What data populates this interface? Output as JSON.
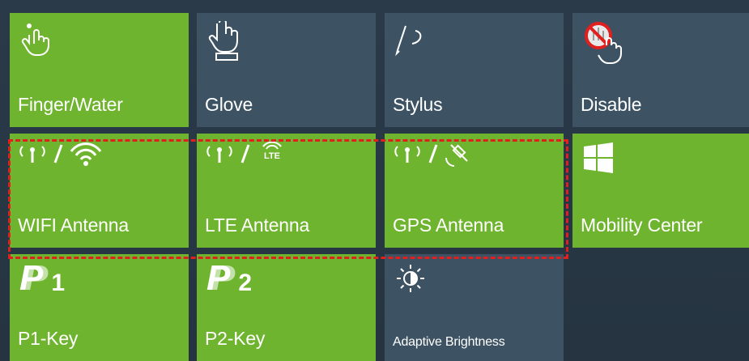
{
  "tiles": {
    "finger_water": {
      "label": "Finger/Water"
    },
    "glove": {
      "label": "Glove"
    },
    "stylus": {
      "label": "Stylus"
    },
    "disable": {
      "label": "Disable"
    },
    "wifi_antenna": {
      "label": "WIFI Antenna"
    },
    "lte_antenna": {
      "label": "LTE Antenna",
      "icon_text": "LTE"
    },
    "gps_antenna": {
      "label": "GPS Antenna"
    },
    "mobility_center": {
      "label": "Mobility Center"
    },
    "p1_key": {
      "label": "P1-Key",
      "icon_digit": "1"
    },
    "p2_key": {
      "label": "P2-Key",
      "icon_digit": "2"
    },
    "adaptive_brightness": {
      "label": "Adaptive Brightness"
    }
  },
  "colors": {
    "tile_active": "#6fb42e",
    "tile_inactive": "#3d5363",
    "background": "#263441",
    "highlight": "#e01f1f"
  }
}
